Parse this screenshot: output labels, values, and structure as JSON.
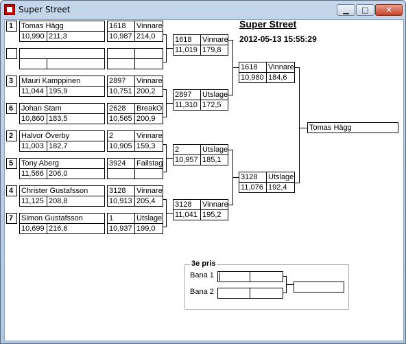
{
  "window": {
    "title": "Super Street",
    "min_glyph": "▁",
    "max_glyph": "□",
    "close_glyph": "✕"
  },
  "event": {
    "heading": "Super Street",
    "timestamp": "2012-05-13 15:55:29"
  },
  "round1": [
    {
      "seed": "1",
      "name": "Tomas Hägg",
      "rt": "10,990",
      "speed": "211,3",
      "opp_no": "1618",
      "result": "Vinnare",
      "opp_rt": "10,987",
      "opp_speed": "214,0"
    },
    {
      "seed": "",
      "name": "",
      "rt": "",
      "speed": "",
      "opp_no": "",
      "result": "",
      "opp_rt": "",
      "opp_speed": ""
    },
    {
      "seed": "3",
      "name": "Mauri Kamppinen",
      "rt": "11,044",
      "speed": "195,9",
      "opp_no": "2897",
      "result": "Vinnare",
      "opp_rt": "10,751",
      "opp_speed": "200,2"
    },
    {
      "seed": "6",
      "name": "Johan Stam",
      "rt": "10,860",
      "speed": "183,5",
      "opp_no": "2628",
      "result": "BreakOut",
      "opp_rt": "10,565",
      "opp_speed": "200,9"
    },
    {
      "seed": "2",
      "name": "Halvor Överby",
      "rt": "11,003",
      "speed": "182,7",
      "opp_no": "2",
      "result": "Vinnare",
      "opp_rt": "10,905",
      "opp_speed": "159,3"
    },
    {
      "seed": "5",
      "name": "Tony Aberg",
      "rt": "11,566",
      "speed": "206,0",
      "opp_no": "3924",
      "result": "Failstage",
      "opp_rt": "",
      "opp_speed": ""
    },
    {
      "seed": "4",
      "name": "Christer Gustafsson",
      "rt": "11,125",
      "speed": "208,8",
      "opp_no": "3128",
      "result": "Vinnare",
      "opp_rt": "10,913",
      "opp_speed": "205,4"
    },
    {
      "seed": "7",
      "name": "Simon Gustafsson",
      "rt": "10,699",
      "speed": "216,6",
      "opp_no": "1",
      "result": "Utslagen",
      "opp_rt": "10,937",
      "opp_speed": "199,0"
    }
  ],
  "round2": [
    {
      "no": "1618",
      "result": "Vinnare",
      "rt": "11,019",
      "speed": "179,8"
    },
    {
      "no": "2897",
      "result": "Utslagen",
      "rt": "11,310",
      "speed": "172,5"
    },
    {
      "no": "2",
      "result": "Utslagen",
      "rt": "10,957",
      "speed": "185,1"
    },
    {
      "no": "3128",
      "result": "Vinnare",
      "rt": "11,041",
      "speed": "195,2"
    }
  ],
  "semis": [
    {
      "no": "1618",
      "result": "Vinnare",
      "rt": "10,980",
      "speed": "184,6"
    },
    {
      "no": "3128",
      "result": "Utslagen",
      "rt": "11,076",
      "speed": "192,4"
    }
  ],
  "winner": "Tomas Hägg",
  "third_place": {
    "title": "3e pris",
    "lane1": "Bana 1",
    "lane2": "Bana 2"
  }
}
